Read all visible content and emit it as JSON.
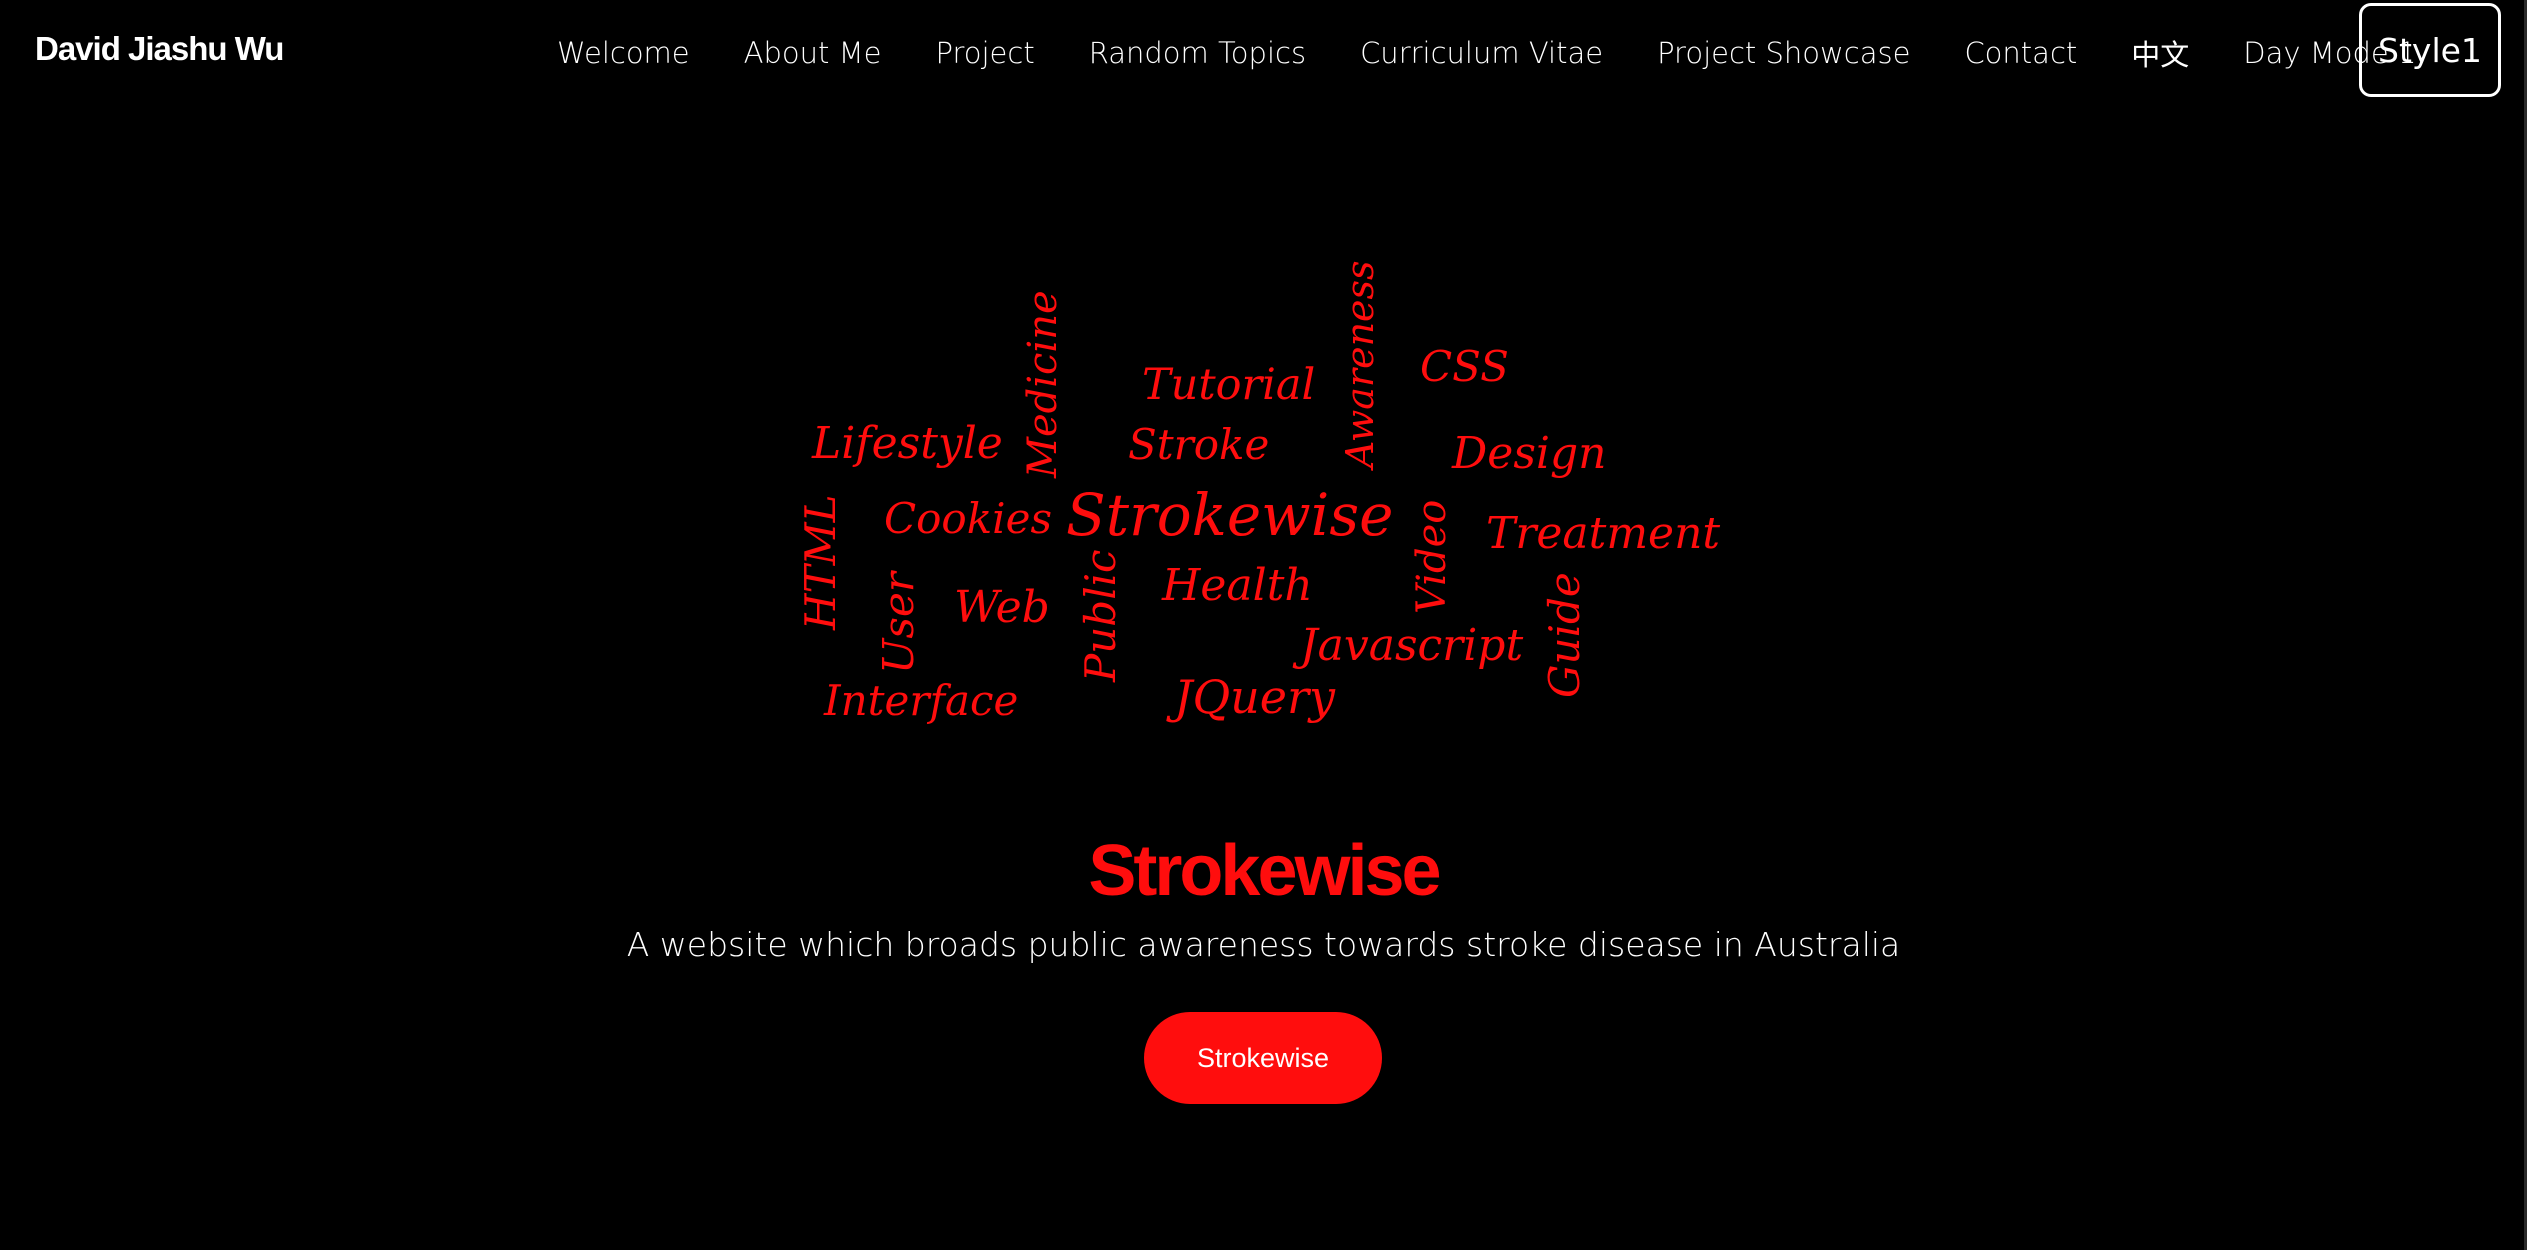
{
  "navbar": {
    "brand": "David Jiashu Wu",
    "links": [
      {
        "label": "Welcome"
      },
      {
        "label": "About Me"
      },
      {
        "label": "Project"
      },
      {
        "label": "Random Topics"
      },
      {
        "label": "Curriculum Vitae"
      },
      {
        "label": "Project Showcase"
      },
      {
        "label": "Contact"
      },
      {
        "label": "中文"
      },
      {
        "label": "Day Mode 1"
      }
    ],
    "style_button_label": "Style1"
  },
  "word_cloud": {
    "color": "#ff0d0d",
    "words": [
      {
        "text": "Medicine"
      },
      {
        "text": "Awareness"
      },
      {
        "text": "Tutorial"
      },
      {
        "text": "CSS"
      },
      {
        "text": "Lifestyle"
      },
      {
        "text": "Stroke"
      },
      {
        "text": "Design"
      },
      {
        "text": "Cookies"
      },
      {
        "text": "Strokewise"
      },
      {
        "text": "Video"
      },
      {
        "text": "Treatment"
      },
      {
        "text": "HTML"
      },
      {
        "text": "User"
      },
      {
        "text": "Web"
      },
      {
        "text": "Public"
      },
      {
        "text": "Health"
      },
      {
        "text": "Javascript"
      },
      {
        "text": "Guide"
      },
      {
        "text": "Interface"
      },
      {
        "text": "JQuery"
      }
    ]
  },
  "hero": {
    "title": "Strokewise",
    "subtitle": "A website which broads public awareness towards stroke disease in Australia",
    "button_label": "Strokewise"
  },
  "colors": {
    "background": "#000000",
    "accent": "#ff0d0d",
    "text": "#ffffff"
  }
}
